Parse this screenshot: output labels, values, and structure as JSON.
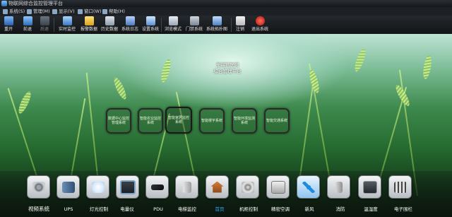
{
  "window": {
    "title": "物联网综合监控管理平台"
  },
  "menubar": {
    "items": [
      {
        "label": "系统(S)",
        "icon": "system-icon"
      },
      {
        "label": "管理(M)",
        "icon": "manage-icon"
      },
      {
        "label": "显示(V)",
        "icon": "view-icon"
      },
      {
        "label": "窗口(W)",
        "icon": "window-icon"
      },
      {
        "label": "帮助(H)",
        "icon": "help-icon"
      }
    ]
  },
  "toolbar": {
    "items": [
      {
        "label": "重开",
        "icon": "reopen-icon"
      },
      {
        "label": "前退",
        "icon": "back-icon"
      },
      {
        "label": "后退",
        "icon": "forward-icon"
      },
      {
        "label": "实时监控",
        "icon": "realtime-monitor-icon"
      },
      {
        "label": "报警数据",
        "icon": "alarm-icon"
      },
      {
        "label": "历史数据",
        "icon": "history-icon"
      },
      {
        "label": "系统日志",
        "icon": "log-icon"
      },
      {
        "label": "设置系统",
        "icon": "settings-icon"
      },
      {
        "label": "浏览模式",
        "icon": "browse-mode-icon"
      },
      {
        "label": "门禁系统",
        "icon": "access-control-icon"
      },
      {
        "label": "系统拓扑图",
        "icon": "topology-icon"
      },
      {
        "label": "注销",
        "icon": "logout-icon"
      },
      {
        "label": "退出系统",
        "icon": "exit-icon"
      }
    ]
  },
  "center": {
    "title_line1": "无锡物联网",
    "title_line2": "综合管理平台"
  },
  "modules": [
    {
      "label": "数据中心监控管理系统"
    },
    {
      "label": "智能农业监控系统"
    },
    {
      "label": "智能家居监控系统"
    },
    {
      "label": "智能楼宇系统"
    },
    {
      "label": "智能环境监测系统"
    },
    {
      "label": "智能交通系统"
    }
  ],
  "dock": {
    "items": [
      {
        "label": "视频系统",
        "icon": "video-camera-icon"
      },
      {
        "label": "UPS",
        "icon": "ups-icon"
      },
      {
        "label": "灯光控制",
        "icon": "light-control-icon"
      },
      {
        "label": "电量仪",
        "icon": "power-meter-icon"
      },
      {
        "label": "PDU",
        "icon": "pdu-icon"
      },
      {
        "label": "电梯监控",
        "icon": "elevator-icon"
      },
      {
        "label": "首页",
        "icon": "home-icon"
      },
      {
        "label": "机柜控制",
        "icon": "cabinet-icon"
      },
      {
        "label": "精密空调",
        "icon": "air-conditioner-icon"
      },
      {
        "label": "新风",
        "icon": "fresh-air-icon"
      },
      {
        "label": "消防",
        "icon": "fire-protection-icon"
      },
      {
        "label": "温湿度",
        "icon": "temperature-humidity-icon"
      },
      {
        "label": "电子围栏",
        "icon": "electronic-fence-icon"
      }
    ],
    "selected": "首页"
  },
  "colors": {
    "selected_label": "#29a8ff",
    "chrome": "#1d2024"
  }
}
